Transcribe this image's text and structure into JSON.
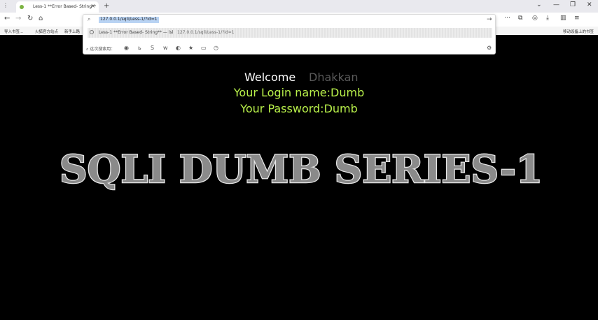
{
  "browser": {
    "tab_title": "Less-1 **Error Based- String**",
    "tab_close": "×",
    "new_tab": "+",
    "controls": {
      "dropdown": "⌄",
      "minimize": "—",
      "restore": "❐",
      "close": "✕"
    },
    "nav": {
      "back": "←",
      "forward": "→",
      "reload": "↻",
      "home": "⌂",
      "go": "→"
    },
    "address_value": "127.0.0.1/sqli/Less-1/?id=1",
    "suggestion": {
      "title": "Less-1 **Error Based- String** — lsl",
      "url": "127.0.0.1/sqli/Less-1/?id=1"
    },
    "search_engines_label": "⌕ 这次搜索用：",
    "bookmarks": [
      "导入书签...",
      "火狐官方站点",
      "新手上路"
    ],
    "bookmarks_right": "移动设备上的书签"
  },
  "page": {
    "welcome": "Welcome",
    "user": "Dhakkan",
    "login_name_line": "Your Login name:Dumb",
    "password_line": "Your Password:Dumb",
    "banner_text": "SQLI DUMB SERIES-1"
  },
  "colors": {
    "background": "#000000",
    "login_text": "#b8f04a",
    "user_name": "#5a5a5a",
    "banner_fill": "#8a8a8a",
    "banner_outline": "#e6e6e6"
  }
}
